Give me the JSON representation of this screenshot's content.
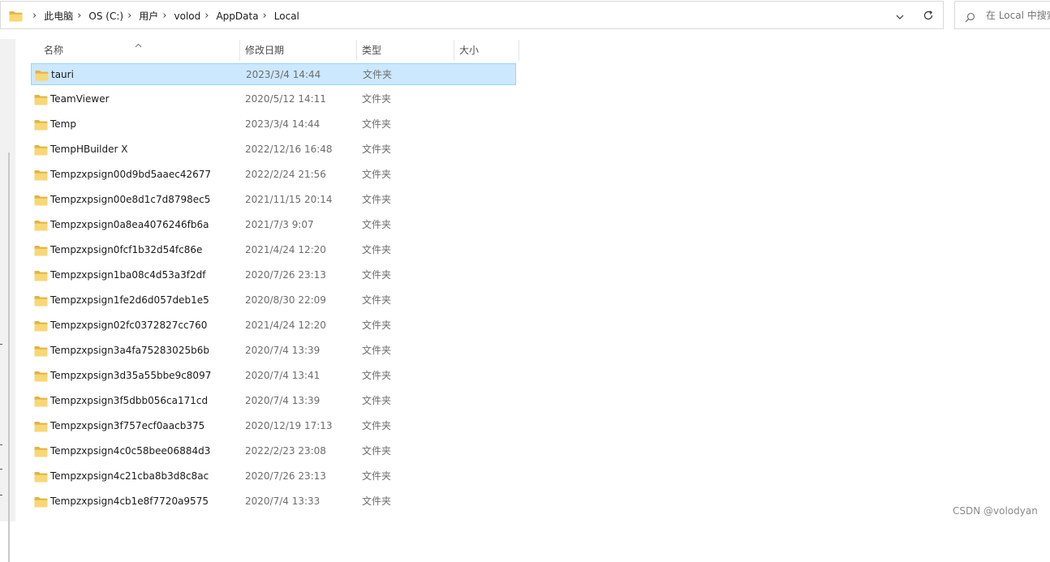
{
  "window": {
    "address_bar": {
      "folder_icon": "folder-icon",
      "breadcrumbs": [
        "此电脑",
        "OS (C:)",
        "用户",
        "volod",
        "AppData",
        "Local"
      ],
      "separator_glyph": "›",
      "dropdown_icon": "chevron-down-icon",
      "refresh_icon": "refresh-icon"
    },
    "search": {
      "icon": "search-icon",
      "placeholder": "在 Local 中搜索"
    }
  },
  "file_list": {
    "columns": [
      "名称",
      "修改日期",
      "类型",
      "大小"
    ],
    "sort_indicator": "^",
    "rows": [
      {
        "name": "tauri",
        "date": "2023/3/4 14:44",
        "type": "文件夹",
        "selected": true
      },
      {
        "name": "TeamViewer",
        "date": "2020/5/12 14:11",
        "type": "文件夹"
      },
      {
        "name": "Temp",
        "date": "2023/3/4 14:44",
        "type": "文件夹"
      },
      {
        "name": "TempHBuilder X",
        "date": "2022/12/16 16:48",
        "type": "文件夹"
      },
      {
        "name": "Tempzxpsign00d9bd5aaec42677",
        "date": "2022/2/24 21:56",
        "type": "文件夹"
      },
      {
        "name": "Tempzxpsign00e8d1c7d8798ec5",
        "date": "2021/11/15 20:14",
        "type": "文件夹"
      },
      {
        "name": "Tempzxpsign0a8ea4076246fb6a",
        "date": "2021/7/3 9:07",
        "type": "文件夹"
      },
      {
        "name": "Tempzxpsign0fcf1b32d54fc86e",
        "date": "2021/4/24 12:20",
        "type": "文件夹"
      },
      {
        "name": "Tempzxpsign1ba08c4d53a3f2df",
        "date": "2020/7/26 23:13",
        "type": "文件夹"
      },
      {
        "name": "Tempzxpsign1fe2d6d057deb1e5",
        "date": "2020/8/30 22:09",
        "type": "文件夹"
      },
      {
        "name": "Tempzxpsign02fc0372827cc760",
        "date": "2021/4/24 12:20",
        "type": "文件夹"
      },
      {
        "name": "Tempzxpsign3a4fa75283025b6b",
        "date": "2020/7/4 13:39",
        "type": "文件夹"
      },
      {
        "name": "Tempzxpsign3d35a55bbe9c8097",
        "date": "2020/7/4 13:41",
        "type": "文件夹"
      },
      {
        "name": "Tempzxpsign3f5dbb056ca171cd",
        "date": "2020/7/4 13:39",
        "type": "文件夹"
      },
      {
        "name": "Tempzxpsign3f757ecf0aacb375",
        "date": "2020/12/19 17:13",
        "type": "文件夹"
      },
      {
        "name": "Tempzxpsign4c0c58bee06884d3",
        "date": "2022/2/23 23:08",
        "type": "文件夹"
      },
      {
        "name": "Tempzxpsign4c21cba8b3d8c8ac",
        "date": "2020/7/26 23:13",
        "type": "文件夹"
      },
      {
        "name": "Tempzxpsign4cb1e8f7720a9575",
        "date": "2020/7/4 13:33",
        "type": "文件夹"
      }
    ]
  },
  "watermark": "CSDN @volodyan",
  "colors": {
    "selection_bg": "#cce8ff",
    "selection_border": "#99d1ff",
    "folder_yellow": "#f8d775",
    "folder_dark": "#e3b341"
  }
}
